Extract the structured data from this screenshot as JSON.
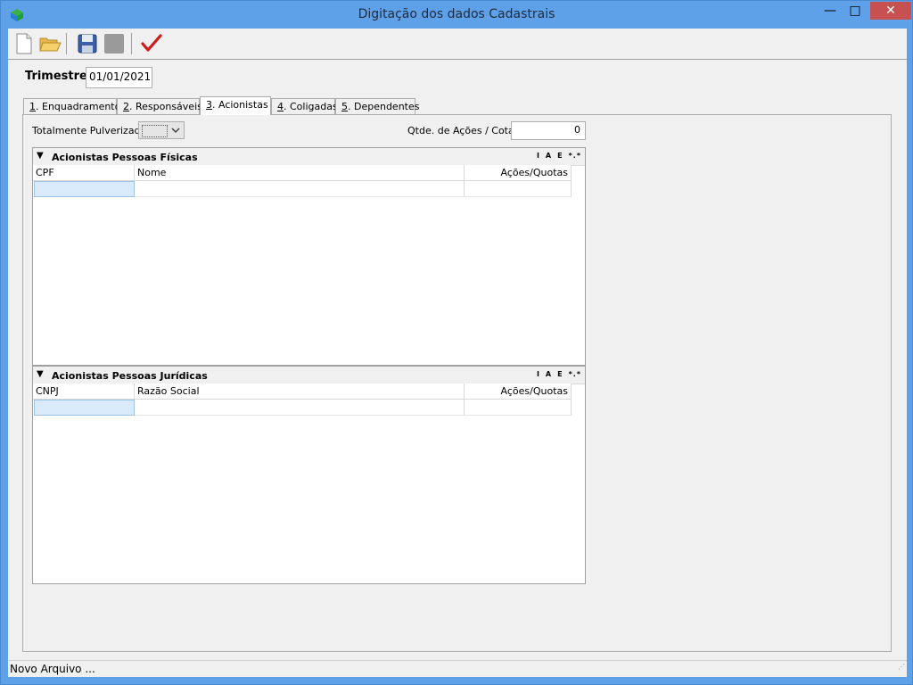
{
  "window": {
    "title": "Digitação dos dados Cadastrais",
    "minimize_label": "—",
    "maximize_label": "□",
    "close_label": "✕"
  },
  "toolbar": {
    "items": [
      {
        "name": "new-file",
        "icon": "new-document-icon"
      },
      {
        "name": "open-file",
        "icon": "folder-open-icon"
      },
      {
        "name": "save",
        "icon": "floppy-disk-icon"
      },
      {
        "name": "disabled",
        "icon": "gray-button-icon"
      },
      {
        "name": "confirm",
        "icon": "red-checkmark-icon"
      }
    ]
  },
  "form": {
    "trimestre_label": "Trimestre",
    "trimestre_value": "01/01/2021"
  },
  "tabs": [
    {
      "num": "1",
      "label": ". Enquadramento"
    },
    {
      "num": "2",
      "label": ". Responsáveis"
    },
    {
      "num": "3",
      "label": ". Acionistas"
    },
    {
      "num": "4",
      "label": ". Coligadas"
    },
    {
      "num": "5",
      "label": ". Dependentes"
    }
  ],
  "active_tab": 2,
  "acionistas": {
    "pulverizado_label": "Totalmente Pulverizado",
    "qtd_label": "Qtde. de Ações / Cotas",
    "qtd_value": "0",
    "fisicas": {
      "title": "Acionistas Pessoas Físicas",
      "actions": [
        "I",
        "A",
        "E",
        "*.*"
      ],
      "columns": [
        "CPF",
        "Nome",
        "Ações/Quotas"
      ]
    },
    "juridicas": {
      "title": "Acionistas Pessoas Jurídicas",
      "actions": [
        "I",
        "A",
        "E",
        "*.*"
      ],
      "columns": [
        "CNPJ",
        "Razão Social",
        "Ações/Quotas"
      ]
    }
  },
  "status": {
    "text": "Novo Arquivo ..."
  },
  "colors": {
    "titlebar": "#5ea1e8",
    "close": "#c75050",
    "selected_cell": "#d9ebfb"
  }
}
